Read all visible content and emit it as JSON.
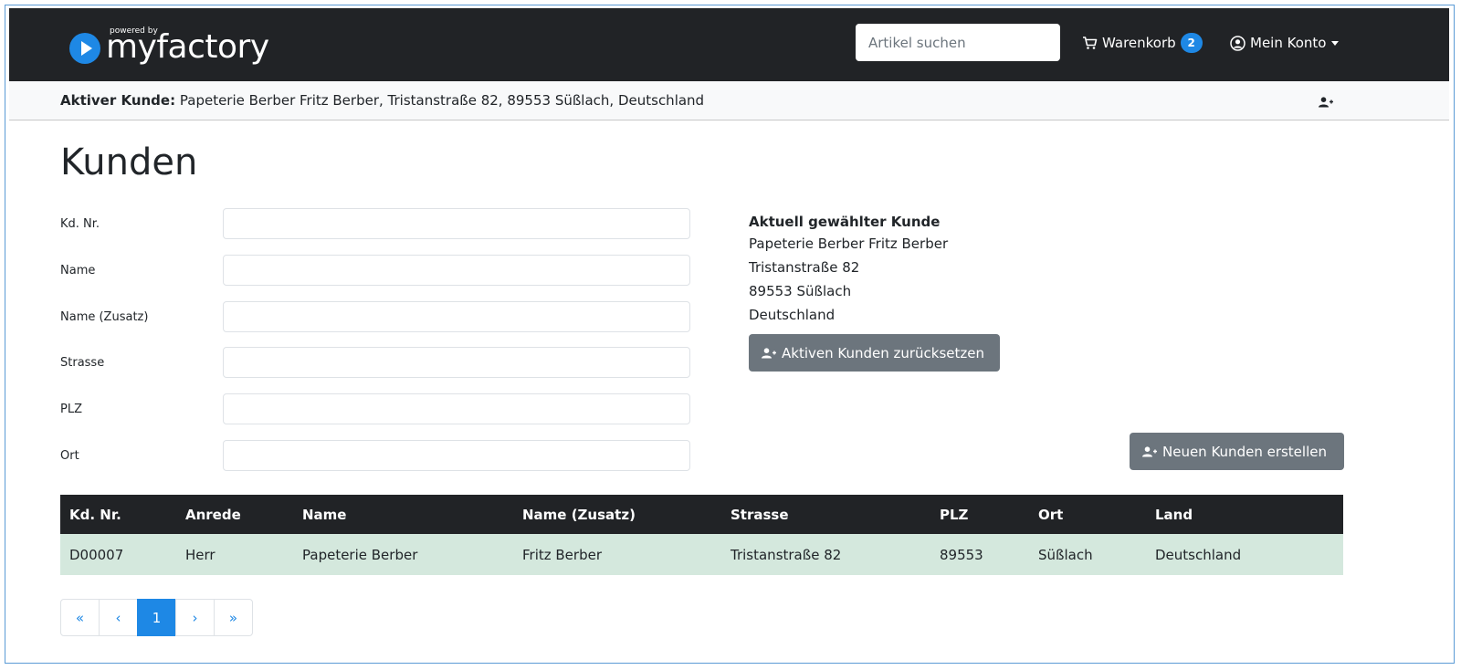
{
  "brand": {
    "powered_by": "powered by",
    "name": "myfactory"
  },
  "header": {
    "search_placeholder": "Artikel suchen",
    "cart_label": "Warenkorb",
    "cart_count": "2",
    "account_label": "Mein Konto"
  },
  "active_customer": {
    "label": "Aktiver Kunde:",
    "value": "Papeterie Berber Fritz Berber, Tristanstraße 82, 89553 Süßlach, Deutschland"
  },
  "page": {
    "title": "Kunden"
  },
  "filters": [
    {
      "label": "Kd. Nr.",
      "value": ""
    },
    {
      "label": "Name",
      "value": ""
    },
    {
      "label": "Name (Zusatz)",
      "value": ""
    },
    {
      "label": "Strasse",
      "value": ""
    },
    {
      "label": "PLZ",
      "value": ""
    },
    {
      "label": "Ort",
      "value": ""
    }
  ],
  "current_customer": {
    "title": "Aktuell gewählter Kunde",
    "lines": [
      "Papeterie Berber Fritz Berber",
      "Tristanstraße 82",
      "89553 Süßlach",
      "Deutschland"
    ],
    "reset_button": "Aktiven Kunden zurücksetzen"
  },
  "new_customer_button": "Neuen Kunden erstellen",
  "table": {
    "headers": [
      "Kd. Nr.",
      "Anrede",
      "Name",
      "Name (Zusatz)",
      "Strasse",
      "PLZ",
      "Ort",
      "Land"
    ],
    "rows": [
      [
        "D00007",
        "Herr",
        "Papeterie Berber",
        "Fritz Berber",
        "Tristanstraße 82",
        "89553",
        "Süßlach",
        "Deutschland"
      ]
    ]
  },
  "pagination": {
    "first": "«",
    "prev": "‹",
    "current": "1",
    "next": "›",
    "last": "»"
  },
  "colors": {
    "navbar": "#212326",
    "accent": "#1e88e5",
    "button": "#6c757d",
    "row_highlight": "#d4e8dd"
  }
}
